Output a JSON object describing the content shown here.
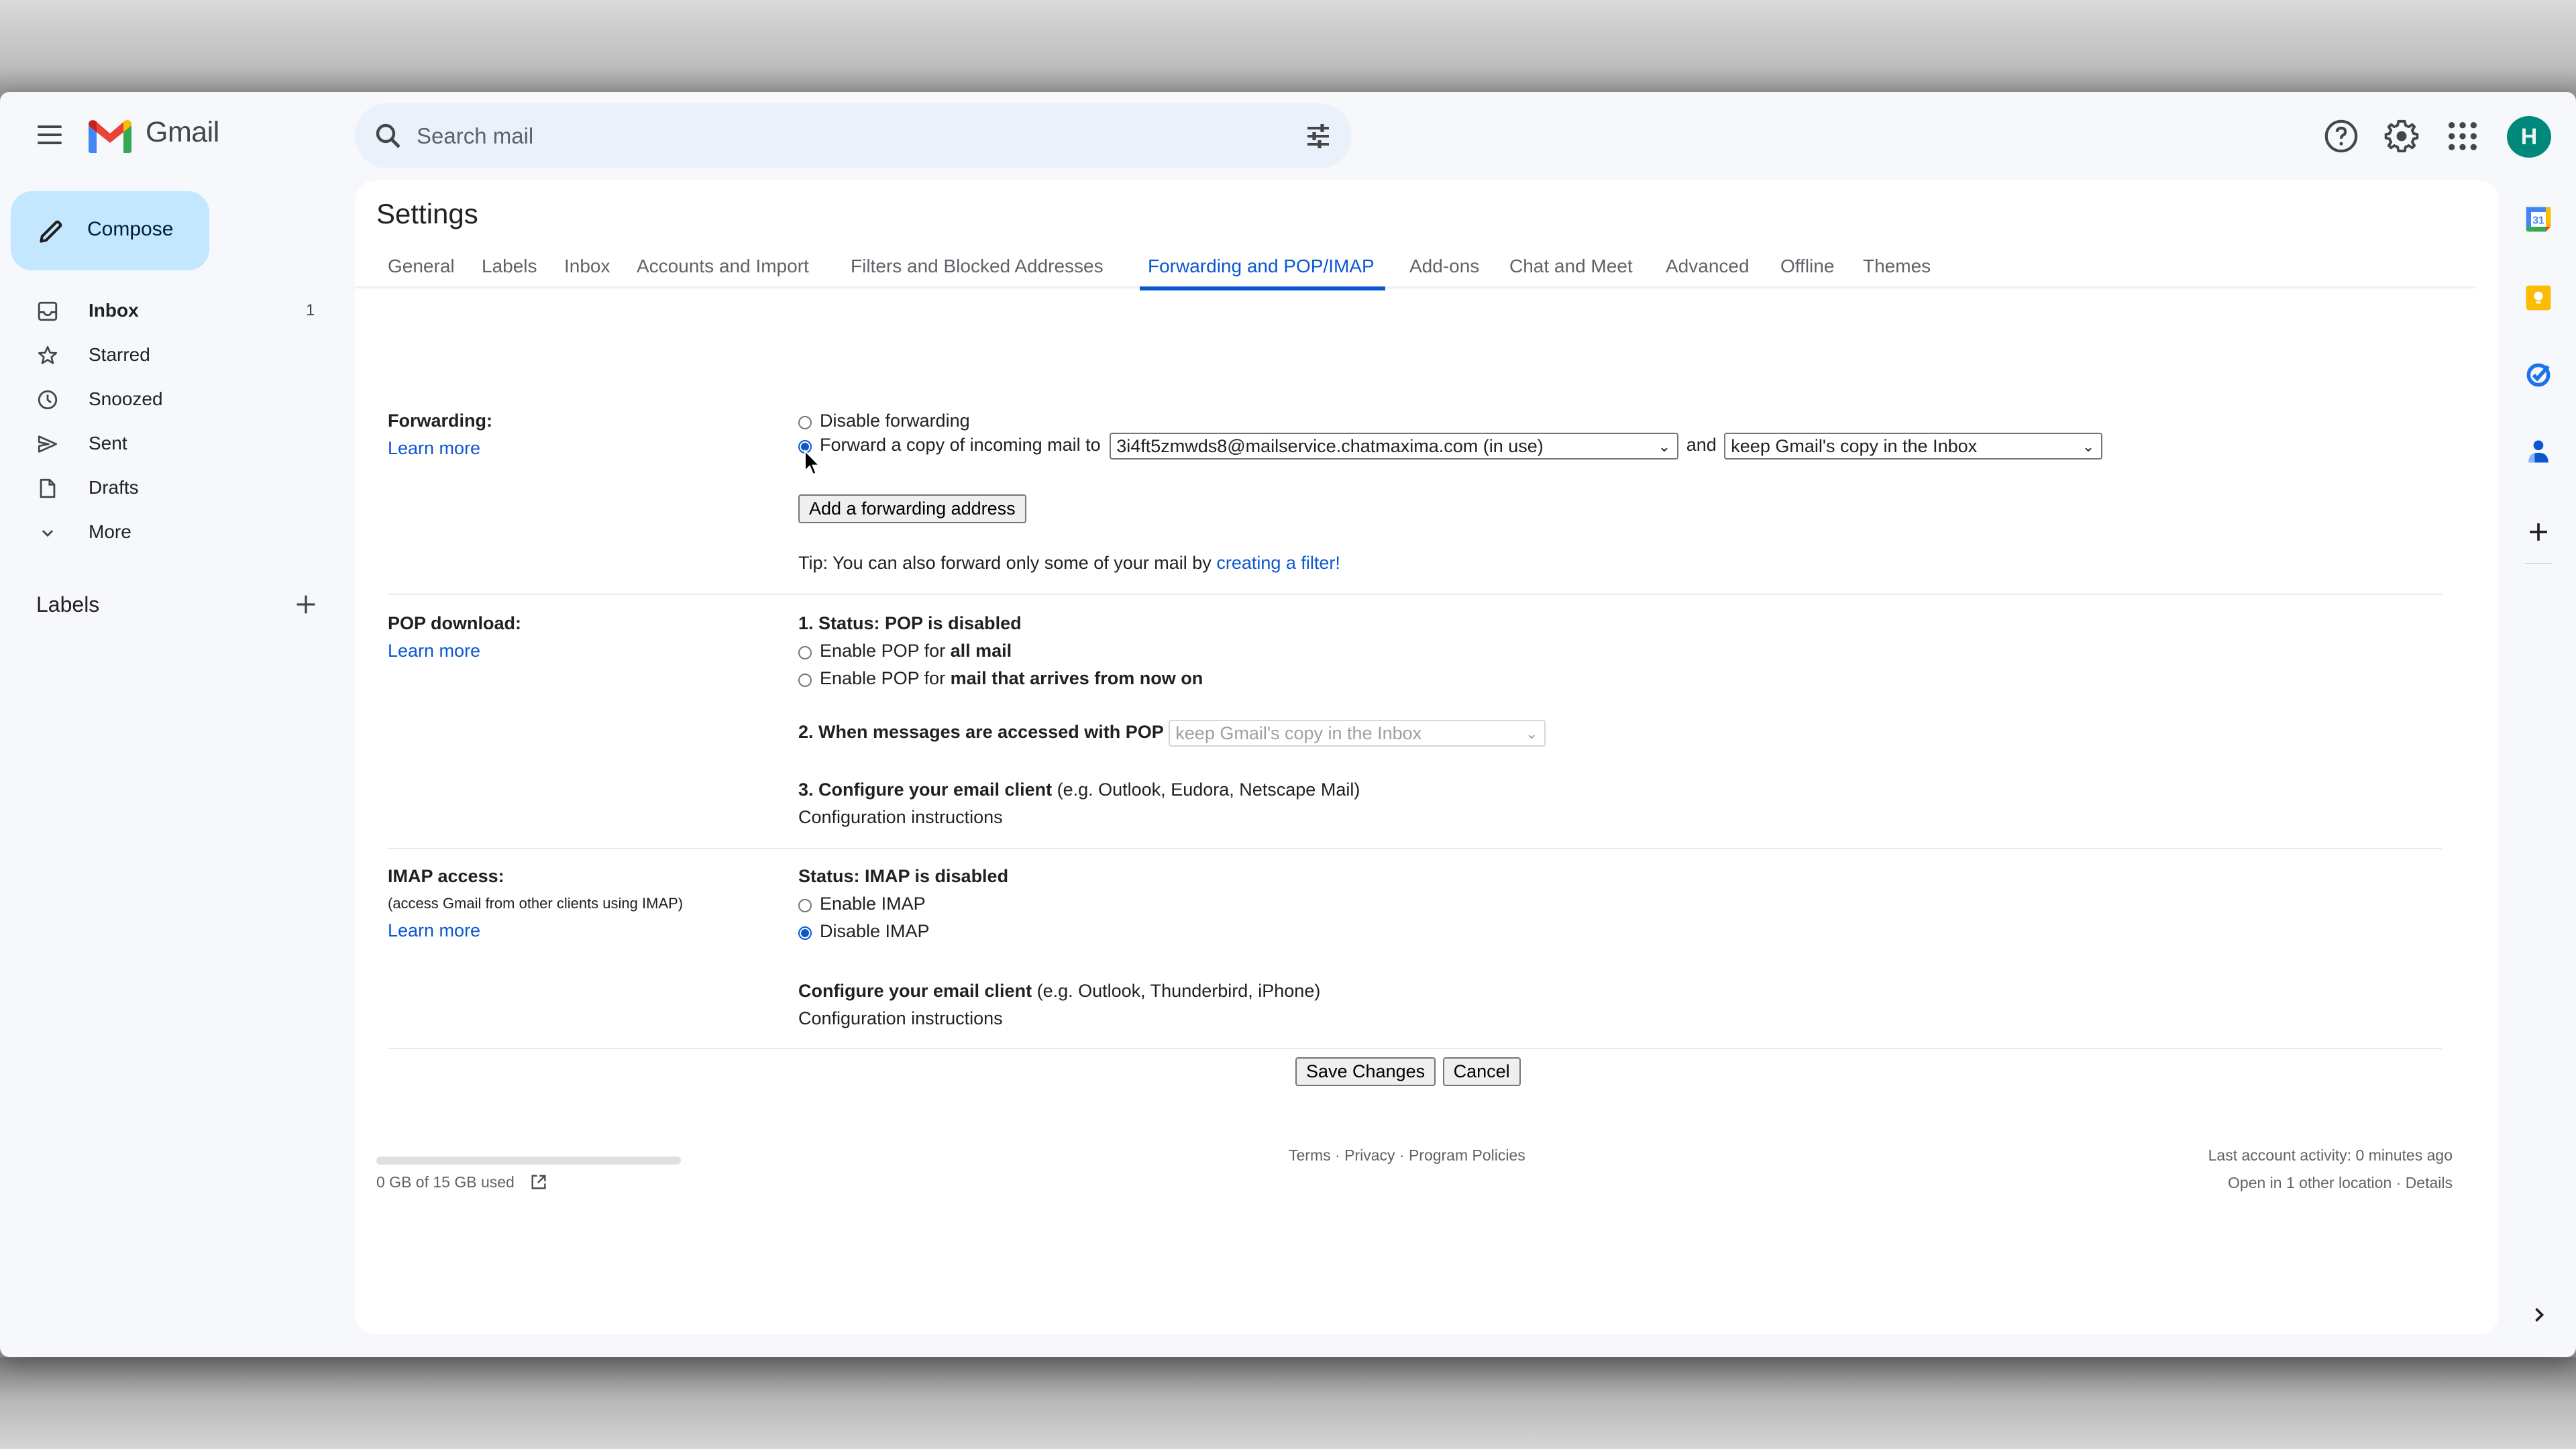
{
  "app": {
    "brand": "Gmail",
    "avatar_initial": "H",
    "colors": {
      "accent": "#0b57d0",
      "compose_bg": "#c2e7ff",
      "avatar_bg": "#00897b"
    }
  },
  "header": {
    "search_placeholder": "Search mail",
    "icons": [
      "menu-icon",
      "search-icon",
      "search-options-icon",
      "help-icon",
      "settings-icon",
      "apps-icon"
    ]
  },
  "sidebar": {
    "compose_label": "Compose",
    "items": [
      {
        "label": "Inbox",
        "count": "1",
        "icon": "inbox-icon",
        "active": true
      },
      {
        "label": "Starred",
        "count": "",
        "icon": "star-icon"
      },
      {
        "label": "Snoozed",
        "count": "",
        "icon": "clock-icon"
      },
      {
        "label": "Sent",
        "count": "",
        "icon": "send-icon"
      },
      {
        "label": "Drafts",
        "count": "",
        "icon": "draft-icon"
      },
      {
        "label": "More",
        "count": "",
        "icon": "chevron-down-icon"
      }
    ],
    "labels_header": "Labels"
  },
  "settings": {
    "title": "Settings",
    "tabs": [
      {
        "label": "General"
      },
      {
        "label": "Labels"
      },
      {
        "label": "Inbox"
      },
      {
        "label": "Accounts and Import"
      },
      {
        "label": "Filters and Blocked Addresses"
      },
      {
        "label": "Forwarding and POP/IMAP",
        "active": true
      },
      {
        "label": "Add-ons"
      },
      {
        "label": "Chat and Meet"
      },
      {
        "label": "Advanced"
      },
      {
        "label": "Offline"
      },
      {
        "label": "Themes"
      }
    ],
    "forwarding": {
      "label": "Forwarding:",
      "learn_more": "Learn more",
      "disable_option": "Disable forwarding",
      "forward_option": "Forward a copy of incoming mail to",
      "selected_option": "forward",
      "address_select": "3i4ft5zmwds8@mailservice.chatmaxima.com (in use)",
      "and_text": "and",
      "action_select": "keep Gmail's copy in the Inbox",
      "add_button": "Add a forwarding address",
      "tip_text": "Tip: You can also forward only some of your mail by",
      "tip_link": "creating a filter!"
    },
    "pop": {
      "label": "POP download:",
      "learn_more": "Learn more",
      "status": "1. Status: POP is disabled",
      "option_all_prefix": "Enable POP for",
      "option_all_bold": "all mail",
      "option_new_prefix": "Enable POP for",
      "option_new_bold": "mail that arrives from now on",
      "step2_label": "2. When messages are accessed with POP",
      "step2_select": "keep Gmail's copy in the Inbox",
      "step3_bold": "3. Configure your email client",
      "step3_rest": "(e.g. Outlook, Eudora, Netscape Mail)",
      "config_link": "Configuration instructions"
    },
    "imap": {
      "label": "IMAP access:",
      "sublabel": "(access Gmail from other clients using IMAP)",
      "learn_more": "Learn more",
      "status": "Status: IMAP is disabled",
      "enable_option": "Enable IMAP",
      "disable_option": "Disable IMAP",
      "selected_option": "disable",
      "configure_bold": "Configure your email client",
      "configure_rest": "(e.g. Outlook, Thunderbird, iPhone)",
      "config_link": "Configuration instructions"
    },
    "save_button": "Save Changes",
    "cancel_button": "Cancel"
  },
  "footer": {
    "storage_text": "0 GB of 15 GB used",
    "storage_used_fraction": 0.0,
    "terms": "Terms",
    "privacy": "Privacy",
    "program_policies": "Program Policies",
    "separator": "·",
    "last_activity": "Last account activity: 0 minutes ago",
    "open_locations": "Open in 1 other location",
    "details": "Details"
  },
  "right_rail": {
    "icons": [
      "calendar-icon",
      "keep-icon",
      "tasks-icon",
      "contacts-icon",
      "add-app-icon",
      "expand-panel-icon"
    ],
    "calendar_day": "31"
  }
}
